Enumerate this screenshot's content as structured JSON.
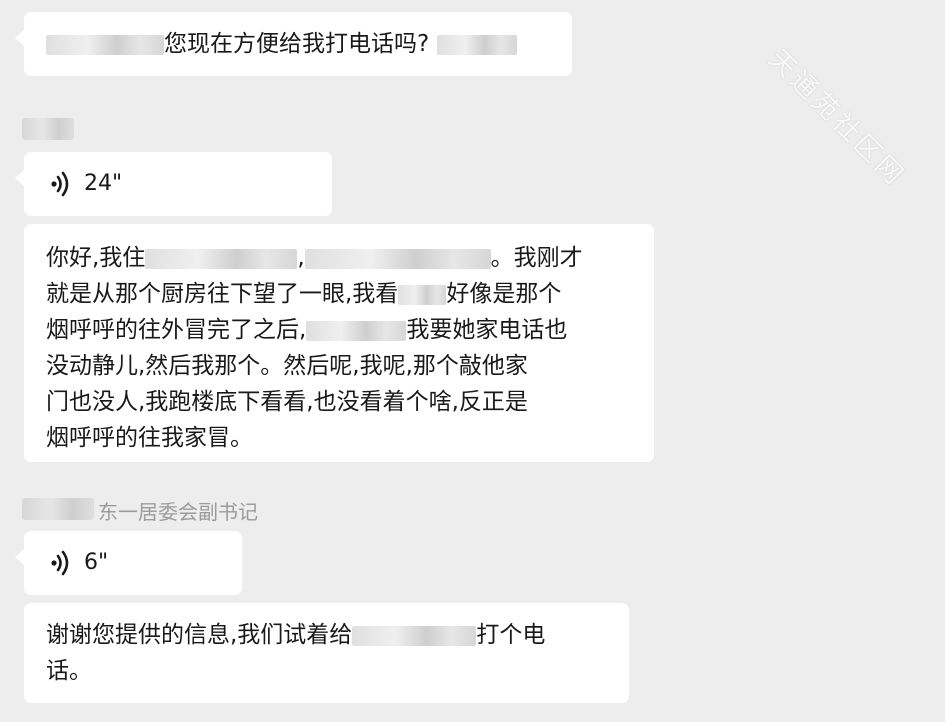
{
  "messages": [
    {
      "type": "text",
      "text": "您现在方便给我打电话吗?"
    },
    {
      "type": "voice",
      "duration": "24\""
    },
    {
      "type": "text",
      "lines": [
        "你好,我住",
        "。我刚才",
        "就是从那个厨房往下望了一眼,我看",
        "好像是那个",
        "烟呼呼的往外冒完了之后,",
        "我要她家电话也",
        "没动静儿,然后我那个。然后呢,我呢,那个敲他家",
        "门也没人,我跑楼底下看看,也没看着个啥,反正是",
        "烟呼呼的往我家冒。"
      ]
    },
    {
      "type": "voice",
      "duration": "6\""
    },
    {
      "type": "text",
      "text_a": "谢谢您提供的信息,我们试着给",
      "text_b": "打个电",
      "text_c": "话。"
    }
  ],
  "sender_role": "东一居委会副书记",
  "watermark": "天通苑社区网"
}
